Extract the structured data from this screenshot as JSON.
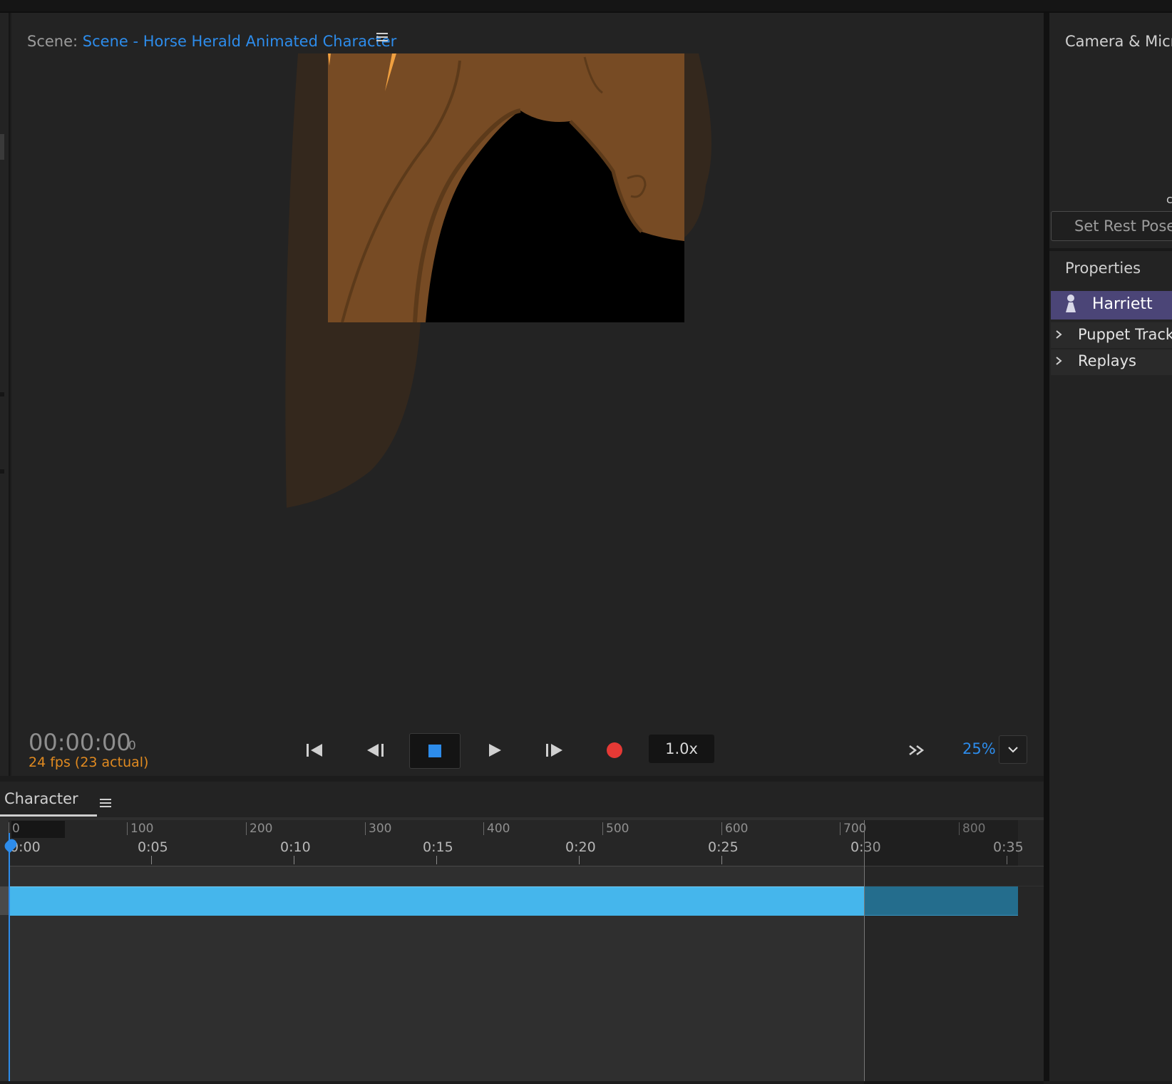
{
  "scene": {
    "label": "Scene:",
    "name": "Scene - Horse Herald Animated Character"
  },
  "transport": {
    "timecode": "00:00:00",
    "frame": "0",
    "fps": "24 fps (23 actual)",
    "speed": "1.0x",
    "zoom": "25%",
    "buttons": [
      "go-to-start",
      "step-back",
      "stop",
      "play",
      "step-forward",
      "record",
      "more"
    ]
  },
  "timeline": {
    "panel_title": "Character",
    "frame_ticks": [
      "0",
      "100",
      "200",
      "300",
      "400",
      "500",
      "600",
      "700",
      "800"
    ],
    "time_ticks": [
      "0:00",
      "0:05",
      "0:10",
      "0:15",
      "0:20",
      "0:25",
      "0:30",
      "0:35"
    ]
  },
  "right_panel": {
    "camera_title": "Camera & Micro",
    "camera_fragment": "c",
    "set_rest_pose": "Set Rest Pose",
    "properties_title": "Properties",
    "puppet_name": "Harriett",
    "sections": [
      "Puppet Track",
      "Replays"
    ]
  },
  "colors": {
    "accent_blue": "#2d8ceb",
    "fps_orange": "#e08a20",
    "record_red": "#e53935",
    "track_blue": "#45b6ec",
    "puppet_row": "#4b4577",
    "horse_brown": "#774b24"
  }
}
